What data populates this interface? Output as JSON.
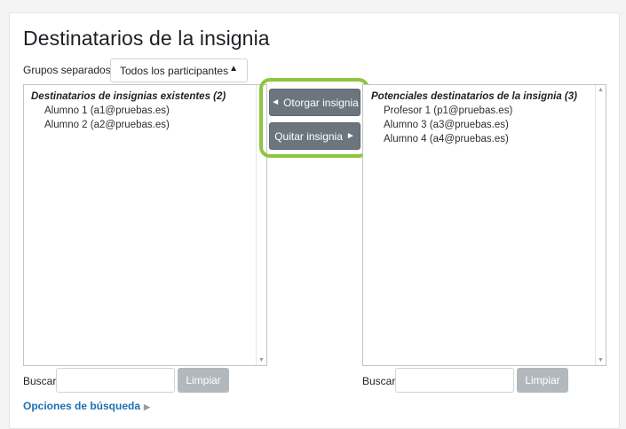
{
  "page": {
    "title": "Destinatarios de la insignia"
  },
  "groups": {
    "label": "Grupos separados",
    "selected": "Todos los participantes"
  },
  "existing": {
    "heading": "Destinatarios de insignias existentes (2)",
    "options": [
      "Alumno 1 (a1@pruebas.es)",
      "Alumno 2 (a2@pruebas.es)"
    ]
  },
  "potential": {
    "heading": "Potenciales destinatarios de la insignia (3)",
    "options": [
      "Profesor 1 (p1@pruebas.es)",
      "Alumno 3 (a3@pruebas.es)",
      "Alumno 4 (a4@pruebas.es)"
    ]
  },
  "actions": {
    "add_label": "Otorgar insignia",
    "remove_label": "Quitar insignia"
  },
  "search": {
    "label": "Buscar",
    "clear_label": "Limpiar",
    "options_link": "Opciones de búsqueda"
  },
  "colors": {
    "highlight": "#8dc63f",
    "button": "#6c757d",
    "link": "#1f6fb2"
  }
}
